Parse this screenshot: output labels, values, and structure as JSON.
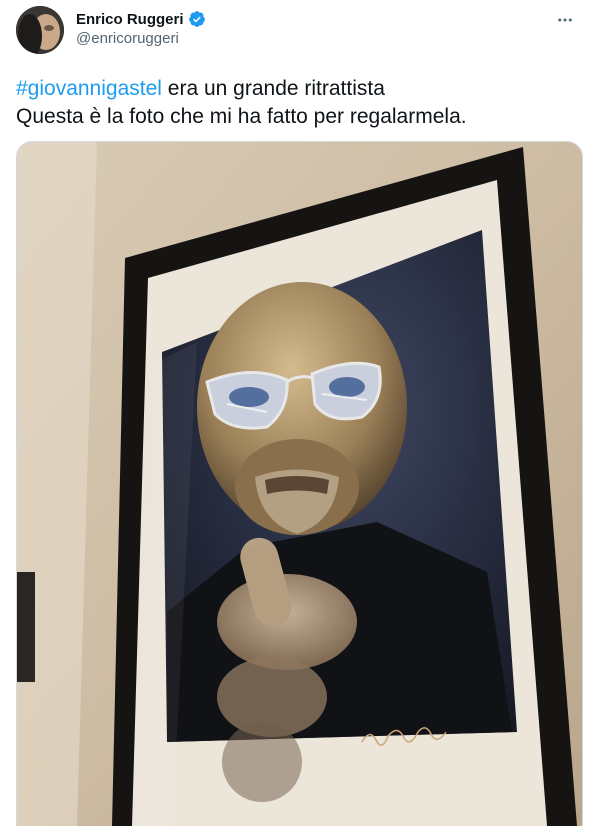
{
  "author": {
    "name": "Enrico Ruggeri",
    "handle": "@enricoruggeri",
    "verified": true
  },
  "tweet": {
    "hashtag": "#giovannigastel",
    "line1_rest": " era un grande ritrattista",
    "line2": "Questa è la foto che mi ha fatto per regalarmela."
  },
  "colors": {
    "link": "#1d9bf0",
    "text": "#0f1419",
    "secondary": "#536471"
  },
  "icons": {
    "verified": "verified-badge-icon",
    "more": "more-options-icon"
  }
}
